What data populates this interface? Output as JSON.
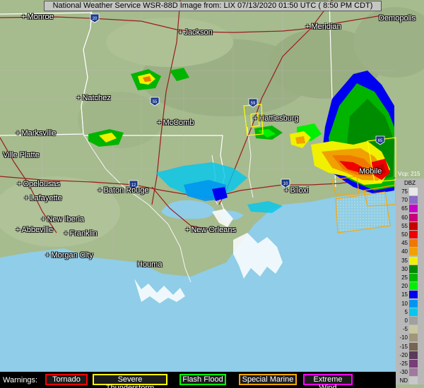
{
  "header": {
    "title": "National Weather Service WSR-88D Image from: LIX 07/13/2020 01:50 UTC ( 8:50 PM CDT)"
  },
  "highway_shields": [
    "20",
    "55",
    "59",
    "12",
    "10",
    "65"
  ],
  "cities": [
    {
      "key": "monroe",
      "name": "Monroe"
    },
    {
      "key": "jackson",
      "name": "Jackson"
    },
    {
      "key": "meridian",
      "name": "Meridian"
    },
    {
      "key": "demopolis",
      "name": "Demopolis"
    },
    {
      "key": "natchez",
      "name": "Natchez"
    },
    {
      "key": "hattiesburg",
      "name": "Hattiesburg"
    },
    {
      "key": "mccomb",
      "name": "McComb"
    },
    {
      "key": "marksville",
      "name": "Marksville"
    },
    {
      "key": "ville_platte",
      "name": "Ville Platte"
    },
    {
      "key": "opelousas",
      "name": "Opelousas"
    },
    {
      "key": "baton_rouge",
      "name": "Baton Rouge"
    },
    {
      "key": "lafayette",
      "name": "Lafayette"
    },
    {
      "key": "biloxi",
      "name": "Biloxi"
    },
    {
      "key": "mobile",
      "name": "Mobile"
    },
    {
      "key": "new_iberia",
      "name": "New Iberia"
    },
    {
      "key": "abbeville",
      "name": "Abbeville"
    },
    {
      "key": "franklin",
      "name": "Franklin"
    },
    {
      "key": "new_orleans",
      "name": "New Orleans"
    },
    {
      "key": "morgan_city",
      "name": "Morgan City"
    },
    {
      "key": "houma",
      "name": "Houma"
    }
  ],
  "legend": {
    "units": "DBZ",
    "vcp": "Vcp: 215",
    "levels": [
      {
        "label": "75",
        "color": "#e8e8e8"
      },
      {
        "label": "70",
        "color": "#8a6cc8"
      },
      {
        "label": "65",
        "color": "#c800c8"
      },
      {
        "label": "60",
        "color": "#c80078"
      },
      {
        "label": "55",
        "color": "#c80000"
      },
      {
        "label": "50",
        "color": "#f00000"
      },
      {
        "label": "45",
        "color": "#f07800"
      },
      {
        "label": "40",
        "color": "#f0a000"
      },
      {
        "label": "35",
        "color": "#f0f000"
      },
      {
        "label": "30",
        "color": "#008c00"
      },
      {
        "label": "25",
        "color": "#00b400"
      },
      {
        "label": "20",
        "color": "#00f000"
      },
      {
        "label": "15",
        "color": "#0000f0"
      },
      {
        "label": "10",
        "color": "#0096f0"
      },
      {
        "label": "5",
        "color": "#00c8f0"
      },
      {
        "label": "0",
        "color": "#a0a0a0"
      },
      {
        "label": "-5",
        "color": "#c8c8a0"
      },
      {
        "label": "-10",
        "color": "#a09678"
      },
      {
        "label": "-15",
        "color": "#786450"
      },
      {
        "label": "-20",
        "color": "#5a3c5a"
      },
      {
        "label": "-25",
        "color": "#783c78"
      },
      {
        "label": "-30",
        "color": "#a078a0"
      },
      {
        "label": "ND",
        "color": "#c8c8c8"
      }
    ]
  },
  "warnings": {
    "label": "Warnings:",
    "items": [
      {
        "key": "tornado",
        "name": "Tornado",
        "color": "#ff0000"
      },
      {
        "key": "severe",
        "name": "Severe Thunderstorm",
        "color": "#ffff00"
      },
      {
        "key": "flood",
        "name": "Flash Flood",
        "color": "#00ff00"
      },
      {
        "key": "marine",
        "name": "Special Marine",
        "color": "#ffa500"
      },
      {
        "key": "wind",
        "name": "Extreme Wind",
        "color": "#ff00ff"
      }
    ]
  },
  "colors": {
    "gulf": "#8fcde8",
    "land": "#a7bd8f",
    "tornado": "#ff0000",
    "severe": "#ffff00",
    "flood": "#00ff00",
    "marine": "#ffa500",
    "wind": "#ff00ff"
  }
}
